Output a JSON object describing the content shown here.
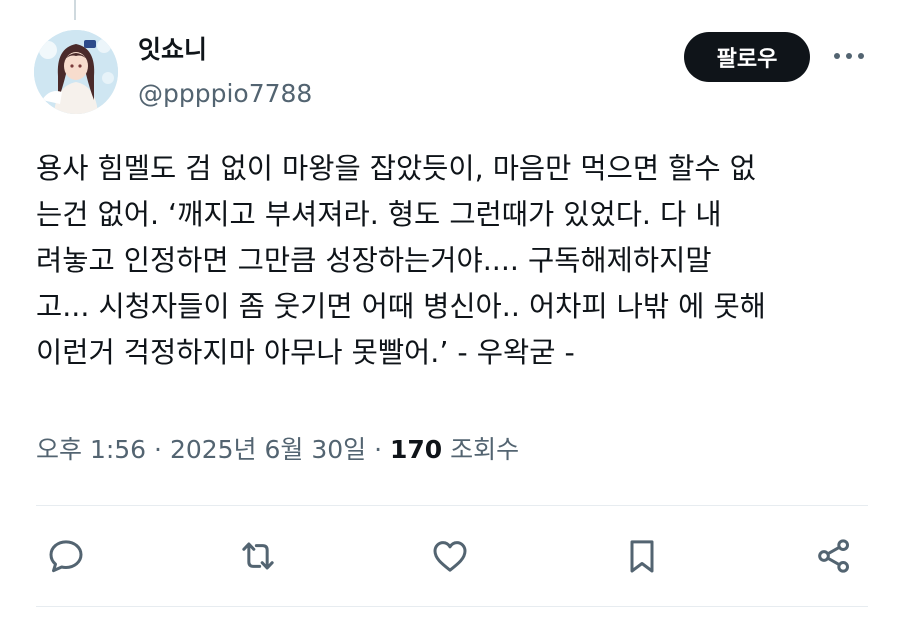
{
  "user": {
    "display_name": "잇쇼니",
    "handle": "@ppppio7788",
    "avatar": "avatar-image"
  },
  "follow_button": {
    "label": "팔로우"
  },
  "more_options": {
    "icon": "more-dots-icon"
  },
  "tweet": {
    "lines": [
      "용사 힘멜도 검 없이 마왕을 잡았듯이, 마음만 먹으면 할수 없",
      "는건 없어.  ‘깨지고 부셔져라. 형도 그런때가 있었다. 다 내",
      "려놓고 인정하면 그만큼 성장하는거야.... 구독해제하지말",
      "고... 시청자들이 좀 웃기면 어때 병신아.. 어차피 나밖 에 못해",
      "이런거 걱정하지마 아무나 못빨어.’ - 우왁굳 -"
    ]
  },
  "meta": {
    "time": "오후 1:56",
    "separator": " · ",
    "date": "2025년 6월 30일",
    "views_count": "170",
    "views_label": " 조회수"
  },
  "actions": [
    {
      "name": "reply",
      "icon": "reply-icon"
    },
    {
      "name": "retweet",
      "icon": "retweet-icon"
    },
    {
      "name": "like",
      "icon": "heart-icon"
    },
    {
      "name": "bookmark",
      "icon": "bookmark-icon"
    },
    {
      "name": "share",
      "icon": "share-icon"
    }
  ],
  "colors": {
    "text": "#0f1419",
    "secondary": "#536471",
    "follow_bg": "#0f1419",
    "divider": "#e7ecf0"
  }
}
